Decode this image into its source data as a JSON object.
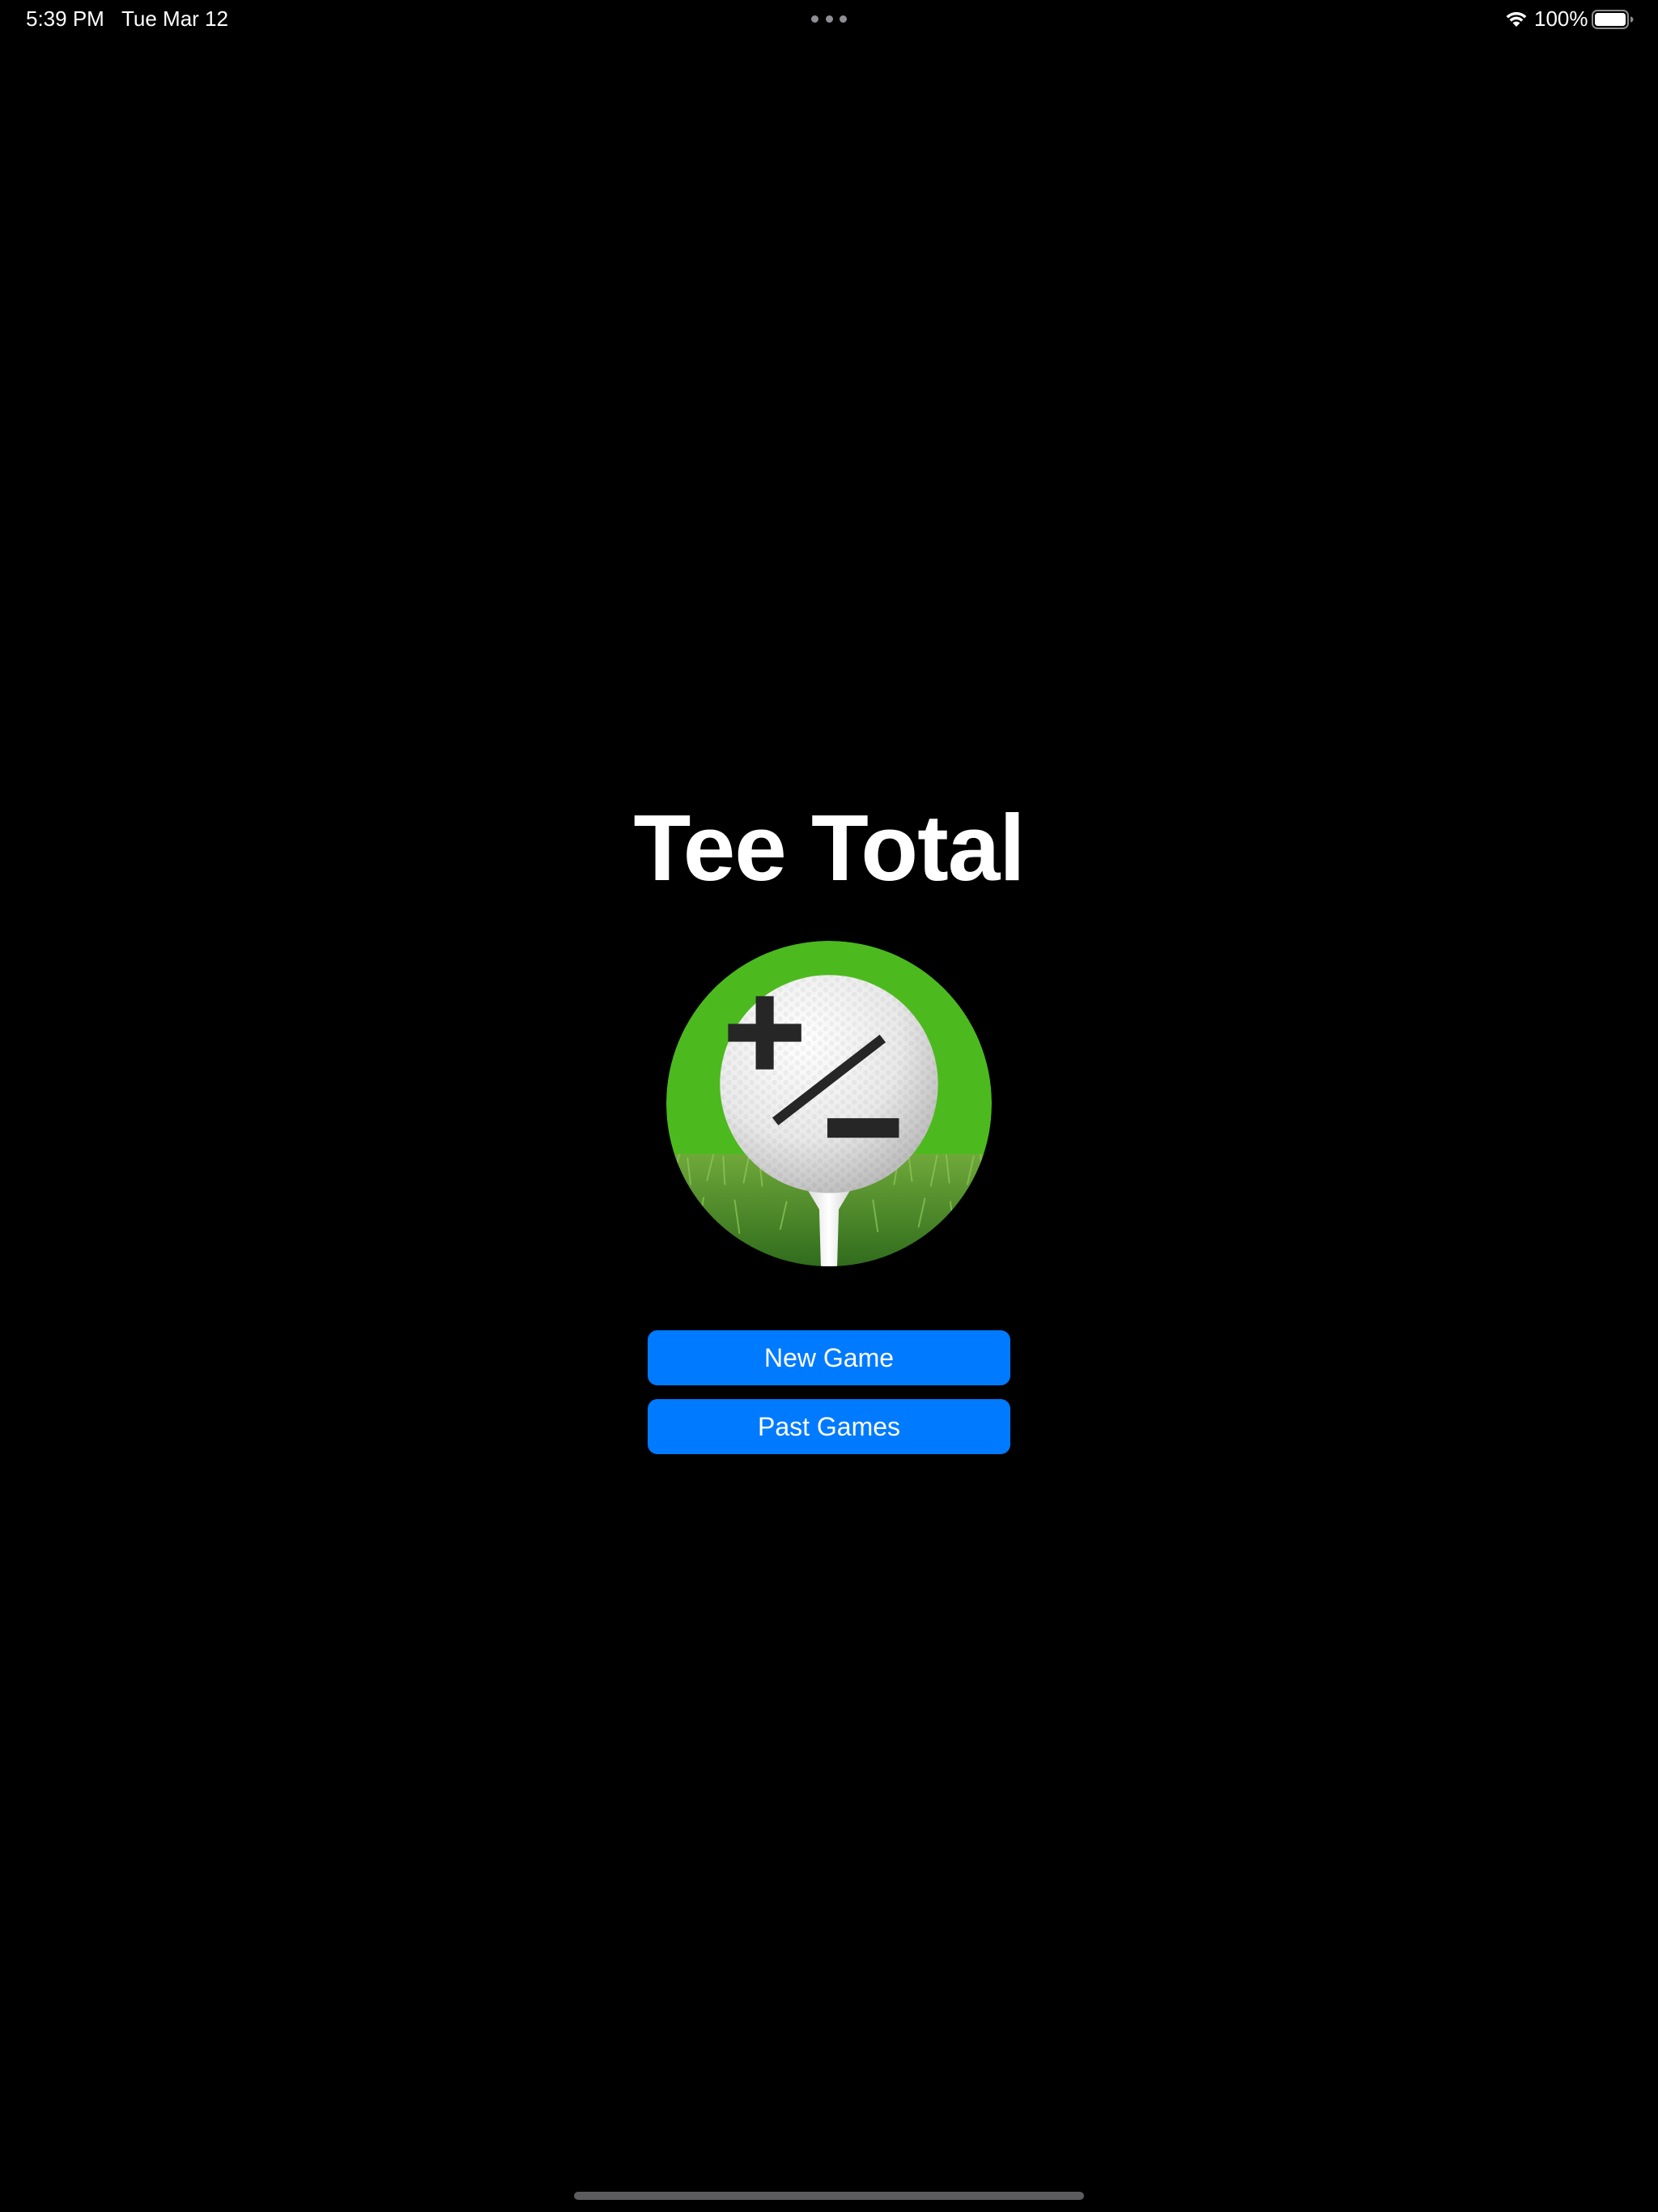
{
  "status_bar": {
    "time": "5:39 PM",
    "date": "Tue Mar 12",
    "battery_percent": "100%",
    "wifi_icon": "wifi-icon",
    "battery_icon": "battery-full-icon",
    "multitask_icon": "ellipsis-icon"
  },
  "main": {
    "title": "Tee Total",
    "logo_icon": "golf-ball-plus-minus-logo",
    "buttons": {
      "new_game": "New Game",
      "past_games": "Past Games"
    }
  },
  "colors": {
    "background": "#000000",
    "button_blue": "#007aff",
    "logo_green": "#4cba1e",
    "text": "#ffffff"
  }
}
